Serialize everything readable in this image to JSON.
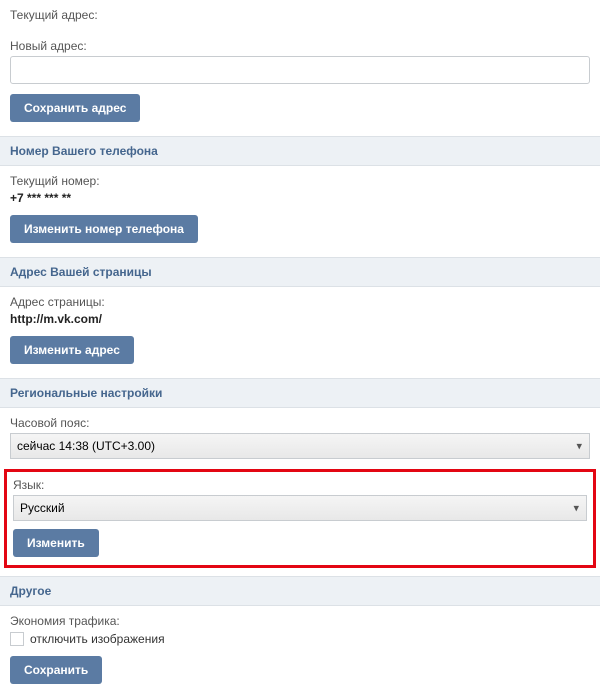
{
  "address": {
    "current_label": "Текущий адрес:",
    "new_label": "Новый адрес:",
    "save_btn": "Сохранить адрес"
  },
  "phone": {
    "header": "Номер Вашего телефона",
    "current_label": "Текущий номер:",
    "current_value": "+7 *** *** **",
    "change_btn": "Изменить номер телефона"
  },
  "page_addr": {
    "header": "Адрес Вашей страницы",
    "label": "Адрес страницы:",
    "value": "http://m.vk.com/",
    "change_btn": "Изменить адрес"
  },
  "regional": {
    "header": "Региональные настройки",
    "tz_label": "Часовой пояс:",
    "tz_value": "сейчас 14:38 (UTC+3.00)",
    "lang_label": "Язык:",
    "lang_value": "Русский",
    "change_btn": "Изменить"
  },
  "other": {
    "header": "Другое",
    "traffic_label": "Экономия трафика:",
    "disable_images": "отключить изображения",
    "save_btn": "Сохранить"
  }
}
